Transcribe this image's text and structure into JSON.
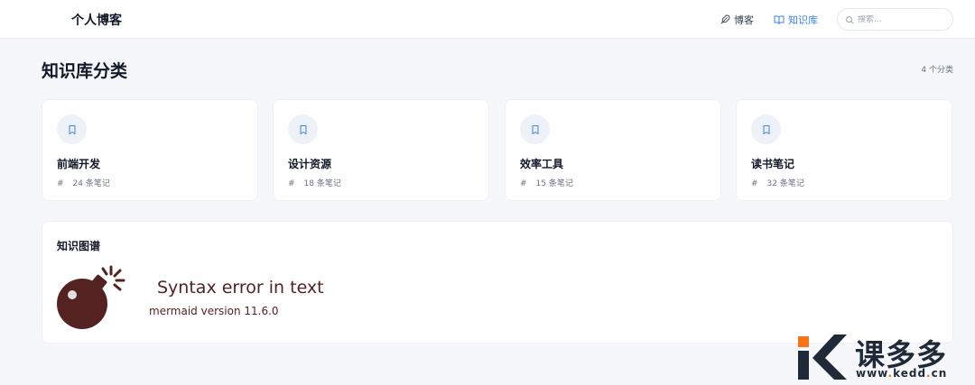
{
  "header": {
    "brand": "个人博客",
    "nav": [
      {
        "label": "博客",
        "icon": "feather-icon"
      },
      {
        "label": "知识库",
        "icon": "book-open-icon",
        "active": true
      }
    ],
    "search_placeholder": "搜索..."
  },
  "main": {
    "title": "知识库分类",
    "count_label": "4 个分类",
    "categories": [
      {
        "name": "前端开发",
        "hash": "#",
        "notes": "24 条笔记",
        "icon": "bookmark-icon"
      },
      {
        "name": "设计资源",
        "hash": "#",
        "notes": "18 条笔记",
        "icon": "bookmark-icon"
      },
      {
        "name": "效率工具",
        "hash": "#",
        "notes": "15 条笔记",
        "icon": "bookmark-icon"
      },
      {
        "name": "读书笔记",
        "hash": "#",
        "notes": "32 条笔记",
        "icon": "bookmark-icon"
      }
    ],
    "graph": {
      "title": "知识图谱",
      "error_title": "Syntax error in text",
      "error_version": "mermaid version 11.6.0",
      "icon": "bomb-icon"
    }
  },
  "watermark": {
    "name": "课多多",
    "url_prefix": "www",
    "url_dot1": ".",
    "url_mid": "kedd",
    "url_dot2": ".",
    "url_suffix": "cn"
  },
  "colors": {
    "accent": "#3b82f6",
    "error_text": "#552222",
    "watermark_orange": "#f97316"
  }
}
